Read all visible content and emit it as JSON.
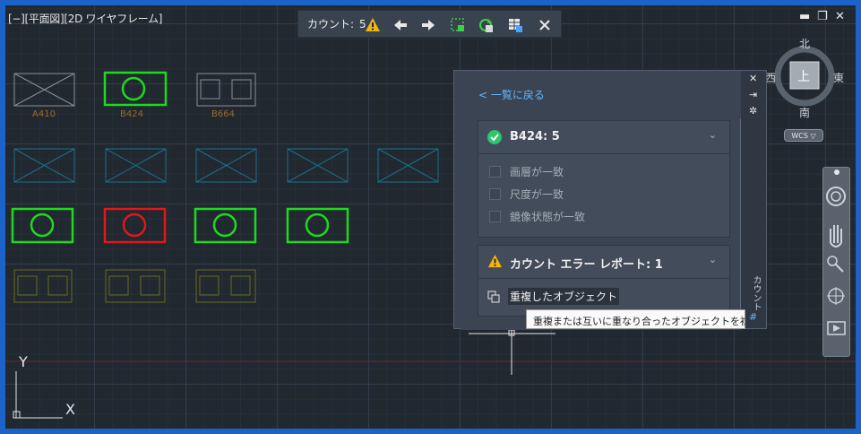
{
  "viewport": {
    "label": "[−][平面図][2D ワイヤフレーム]"
  },
  "count_toolbar": {
    "label": "カウント:",
    "count": "5",
    "icons": [
      "warning-icon",
      "arrow-left-icon",
      "arrow-right-icon",
      "selection-box-icon",
      "refresh-count-icon",
      "insert-table-icon",
      "close-icon"
    ]
  },
  "drawing": {
    "block_labels": [
      "A410",
      "B424",
      "B664"
    ]
  },
  "palette": {
    "back_link": "< 一覧に戻る",
    "card1": {
      "title": "B424: 5",
      "checks": [
        "画層が一致",
        "尺度が一致",
        "鏡像状態が一致"
      ]
    },
    "card2": {
      "title": "カウント エラー レポート: 1",
      "item": "重複したオブジェクト"
    },
    "side_title": "カウント"
  },
  "tooltip": "重複または互いに重なり合ったオブジェクトを複製",
  "viewcube": {
    "north": "北",
    "south": "南",
    "east": "東",
    "west": "西",
    "face": "上",
    "wcs": "WCS ▽"
  },
  "ucs": {
    "x": "X",
    "y": "Y"
  },
  "colors": {
    "ok": "#1fd91f",
    "error": "#e01818",
    "warning": "#f2b40d",
    "link": "#5fb7ff",
    "block_cyan": "#1e6e8c",
    "block_olive": "#6b6a1e"
  }
}
